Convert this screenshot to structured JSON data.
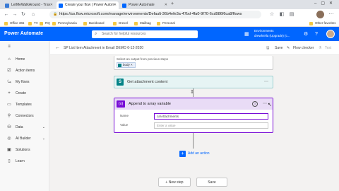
{
  "browser": {
    "tabs": [
      {
        "title": "LetMeWalkAround - Trav",
        "active": false
      },
      {
        "title": "Create your flow | Power Autom",
        "active": true
      },
      {
        "title": "Power Automate",
        "active": false
      }
    ],
    "url": "https://us.flow.microsoft.com/manage/environments/Default-36b4efe3a-47bd-4fa0-9f70-6cd986f6ca8/flows",
    "bookmarks": [
      "Office 365",
      "TV",
      "RQ",
      "Pennsylvania",
      "Backboard",
      "Drexel",
      "Mailbag",
      "Personal"
    ],
    "other_favorites": "Other favorites"
  },
  "header": {
    "brand": "Power Automate",
    "search_placeholder": "Search for helpful resources",
    "environment_label": "Environments",
    "environment_name": "drewhiella (Upgrade) (c..."
  },
  "sidebar": {
    "items": [
      {
        "label": "Home",
        "icon": "home-icon"
      },
      {
        "label": "Action items",
        "icon": "check-icon"
      },
      {
        "label": "My flows",
        "icon": "flow-icon"
      },
      {
        "label": "Create",
        "icon": "plus-icon"
      },
      {
        "label": "Templates",
        "icon": "template-icon"
      },
      {
        "label": "Connectors",
        "icon": "connector-icon"
      },
      {
        "label": "Data",
        "icon": "data-icon"
      },
      {
        "label": "AI Builder",
        "icon": "ai-icon"
      },
      {
        "label": "Solutions",
        "icon": "solutions-icon"
      },
      {
        "label": "Learn",
        "icon": "learn-icon"
      }
    ]
  },
  "cmdbar": {
    "flow_title": "SP List Item Attachment in Email DEMO 6-12-2020",
    "save": "Save",
    "flow_checker": "Flow checker",
    "test": "Test"
  },
  "canvas": {
    "select_output_label": "Select an output from previous steps",
    "token": "body",
    "get_attachment_title": "Get attachment content",
    "append_title": "Append to array variable",
    "name_label": "Name",
    "name_value": "ca/Attachments",
    "value_label": "Value",
    "value_placeholder": "Enter a value",
    "add_action": "Add an action",
    "new_step": "+ New step",
    "save_button": "Save"
  },
  "colors": {
    "accent": "#0066ff",
    "variable": "#770bd6",
    "sharepoint": "#038387"
  }
}
